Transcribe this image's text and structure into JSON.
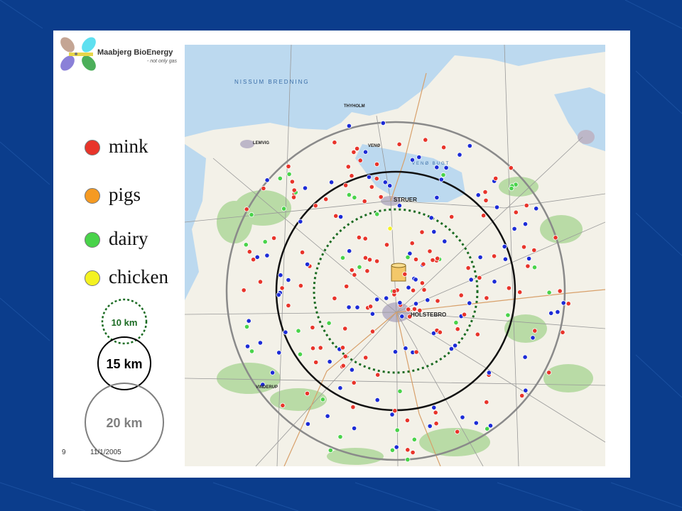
{
  "brand": {
    "name": "Maabjerg BioEnergy",
    "tagline": "- not only gas"
  },
  "legend": {
    "items": [
      {
        "label": "mink",
        "color": "#e8342a"
      },
      {
        "label": "pigs",
        "color": "#f59a22"
      },
      {
        "label": "dairy",
        "color": "#49d34a"
      },
      {
        "label": "chicken",
        "color": "#f4f221"
      }
    ],
    "rings": [
      {
        "label": "10 km",
        "color": "#1a6b22"
      },
      {
        "label": "15 km",
        "color": "#000000"
      },
      {
        "label": "20 km",
        "color": "#7f7f7f"
      }
    ]
  },
  "footer": {
    "page": "9",
    "date": "11/1/2005"
  },
  "map": {
    "water_labels": [
      "NISSUM BREDNING",
      "VENØ BUGT"
    ],
    "towns": [
      "STRUER",
      "HOLSTEBRO",
      "LEMVIG",
      "THYHOLM",
      "VENØ",
      "VINDERUP"
    ],
    "colors": {
      "water": "#bcd9ef",
      "forest": "#b9dba6",
      "farm_blue": "#1c2bd6"
    }
  }
}
